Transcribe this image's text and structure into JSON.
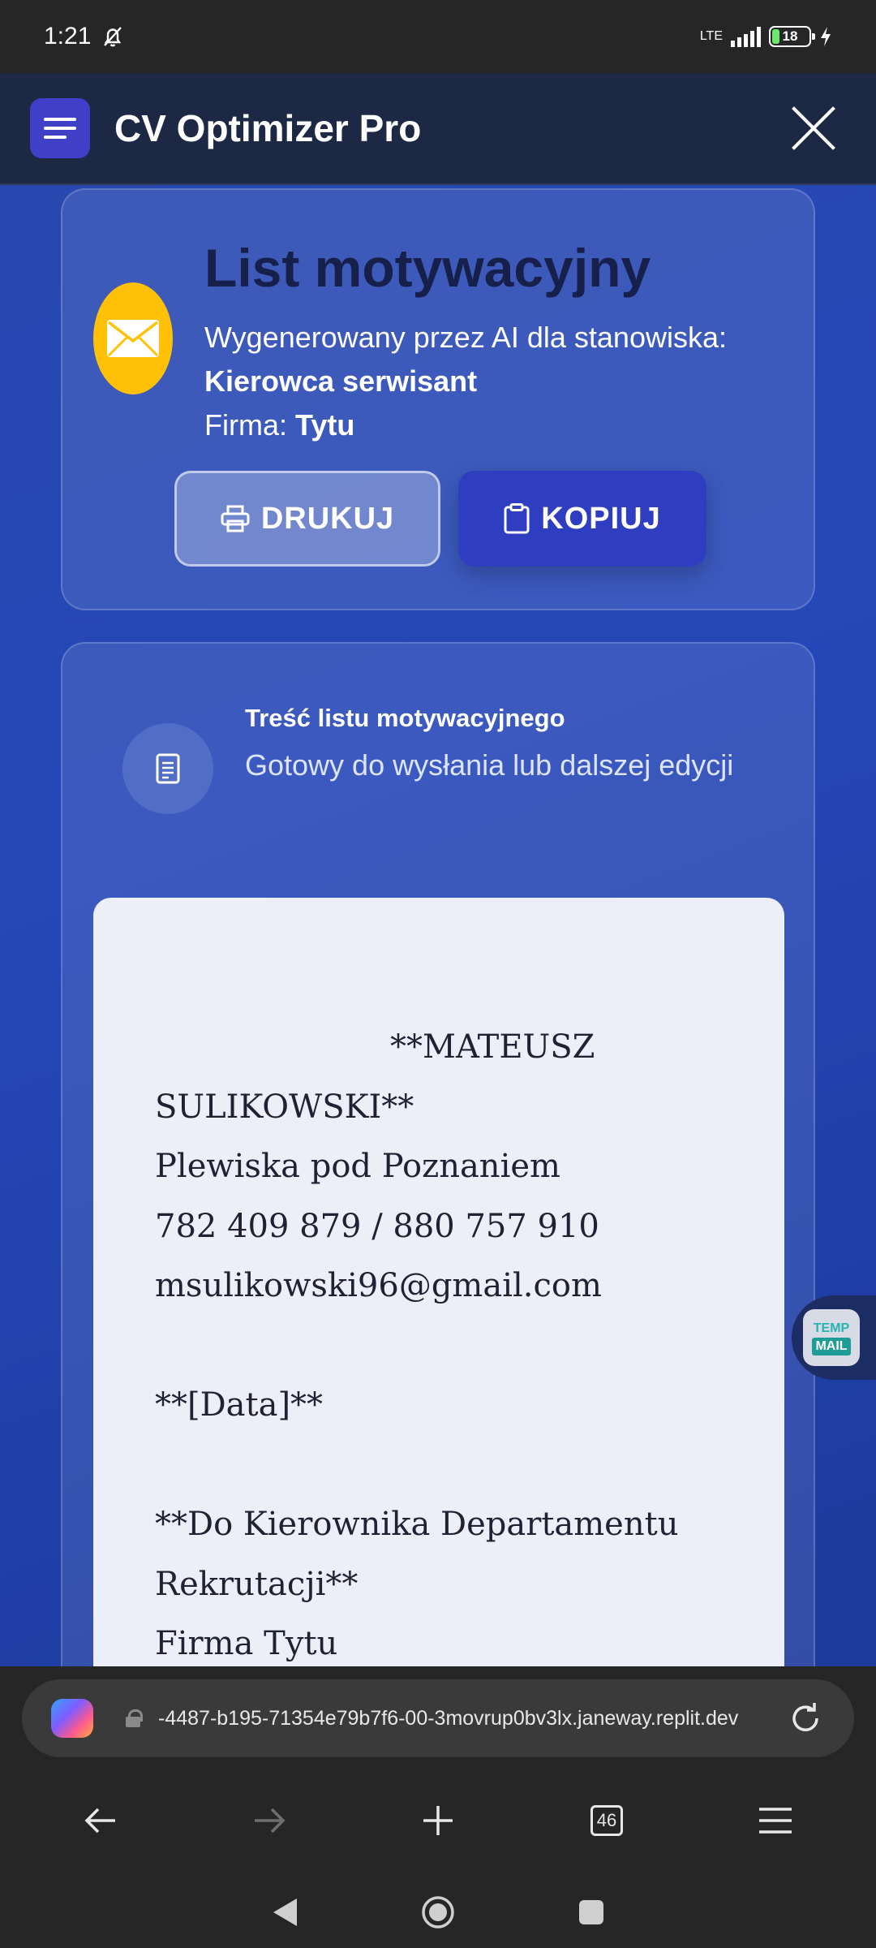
{
  "status_bar": {
    "time": "1:21",
    "network": "LTE",
    "battery": "18"
  },
  "app": {
    "title": "CV Optimizer Pro"
  },
  "top_card": {
    "title": "List motywacyjny",
    "subtitle": "Wygenerowany przez AI dla stanowiska:",
    "position": "Kierowca serwisant",
    "company_label": "Firma:",
    "company": "Tytu",
    "print_label": "DRUKUJ",
    "copy_label": "KOPIUJ"
  },
  "content_card": {
    "title": "Treść listu motywacyjnego",
    "subtitle": "Gotowy do wysłania lub dalszej edycji"
  },
  "letter": {
    "lines": [
      "**MATEUSZ",
      "SULIKOWSKI**",
      "Plewiska pod Poznaniem",
      "782 409 879 / 880 757 910",
      "msulikowski96@gmail.com",
      "",
      "**[Data]**",
      "",
      "**Do Kierownika Departamentu",
      "Rekrutacji**",
      "Firma Tytu"
    ]
  },
  "temp_mail": {
    "line1": "TEMP",
    "line2": "MAIL"
  },
  "browser": {
    "url": "-4487-b195-71354e79b7f6-00-3movrup0bv3lx.janeway.replit.dev",
    "tab_count": "46"
  },
  "colors": {
    "accent": "#3f3fc8",
    "content_bg": "#2547b8",
    "header_bg": "#1c2844",
    "icon_yellow": "#ffc107"
  }
}
